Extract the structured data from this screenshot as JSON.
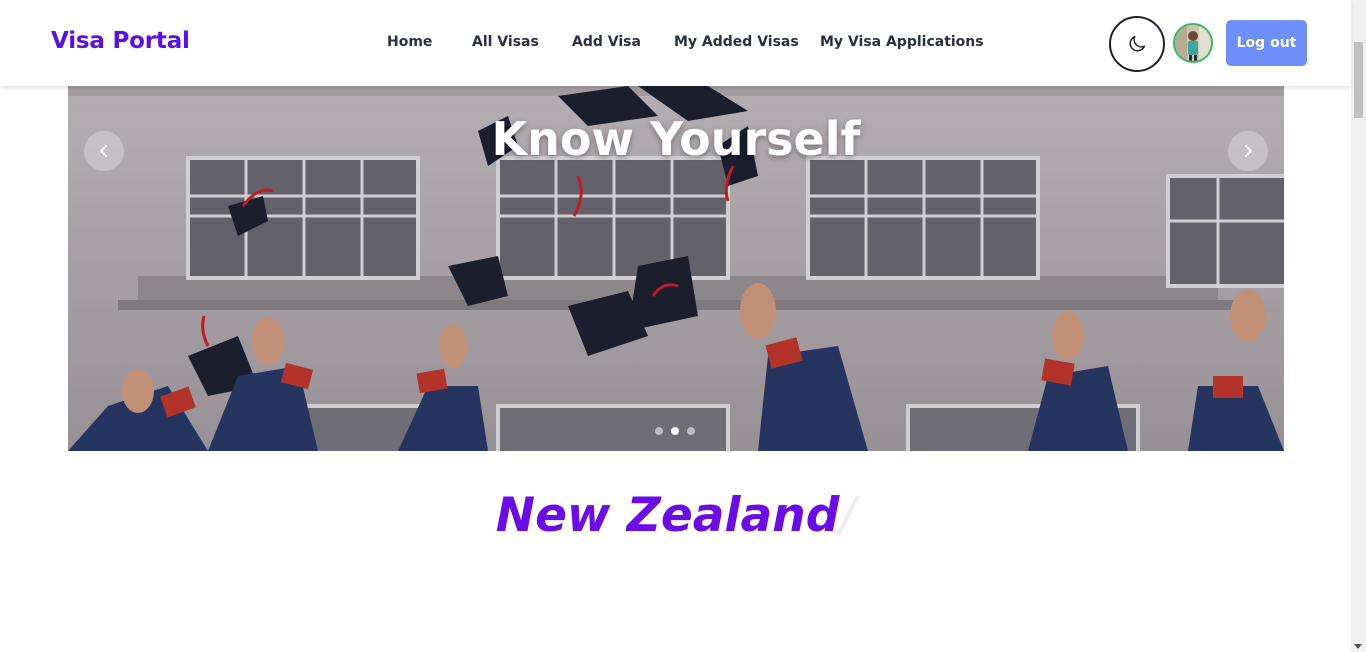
{
  "header": {
    "brand": "Visa Portal",
    "nav": [
      {
        "label": "Home"
      },
      {
        "label": "All Visas"
      },
      {
        "label": "Add Visa"
      },
      {
        "label": "My Added Visas"
      },
      {
        "label": "My Visa Applications"
      }
    ],
    "theme_toggle_icon": "moon-icon",
    "avatar_icon": "user-avatar",
    "logout_label": "Log out"
  },
  "carousel": {
    "title": "Know Yourself",
    "prev_icon": "chevron-left-icon",
    "next_icon": "chevron-right-icon",
    "slide_count": 3,
    "active_index": 1
  },
  "hero": {
    "typed_text": "New Zealand",
    "cursor": "/"
  },
  "colors": {
    "brand": "#5b0fe6",
    "logout_button": "#6e8ff8",
    "typed_text": "#6a0be8",
    "avatar_border": "#2fbf5a"
  }
}
